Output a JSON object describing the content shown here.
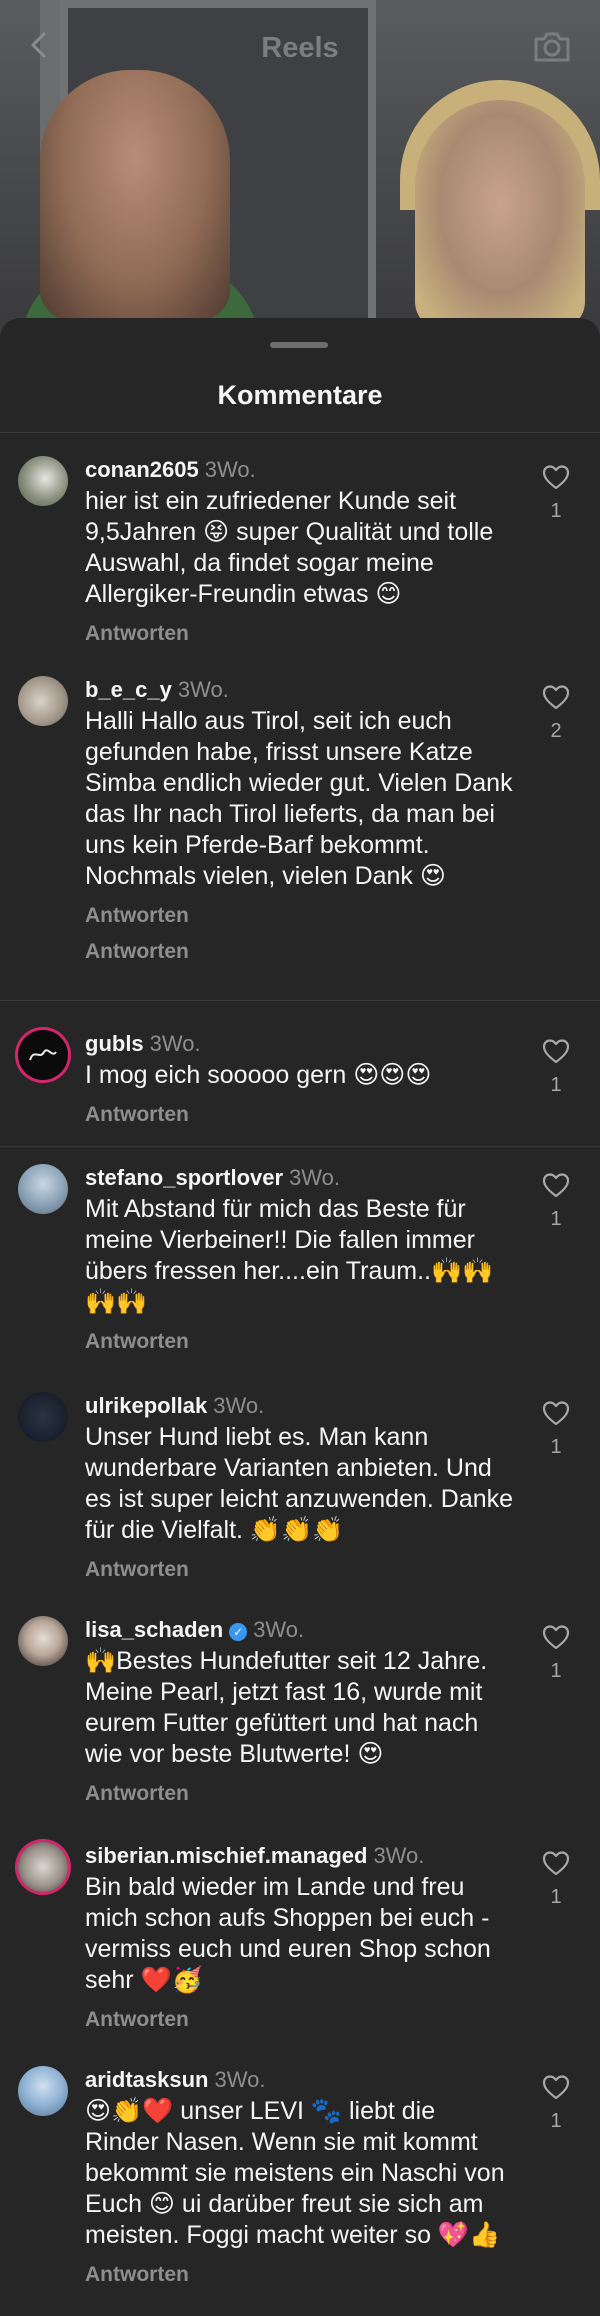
{
  "header": {
    "title": "Reels",
    "back_icon": "chevron-left-icon",
    "camera_icon": "camera-icon"
  },
  "sheet": {
    "title": "Kommentare"
  },
  "comments": [
    {
      "username": "conan2605",
      "time": "3Wo.",
      "verified": false,
      "text": "hier ist ein zufriedener Kunde seit 9,5Jahren 😝 super Qualität und tolle Auswahl, da findet sogar meine Allergiker-Freundin etwas 😊",
      "reply": "Antworten",
      "likes": "1"
    },
    {
      "username": "b_e_c_y",
      "time": "3Wo.",
      "verified": false,
      "text": "Halli Hallo aus Tirol, seit ich euch gefunden habe, frisst unsere Katze Simba endlich wieder gut. Vielen Dank das Ihr nach Tirol lieferts, da man bei uns kein Pferde-Barf bekommt. Nochmals vielen, vielen Dank 😍",
      "reply": "Antworten",
      "reply2": "Antworten",
      "likes": "2"
    },
    {
      "username": "gubls",
      "time": "3Wo.",
      "verified": false,
      "text": "I mog eich sooooo gern 😍😍😍",
      "reply": "Antworten",
      "likes": "1"
    },
    {
      "username": "stefano_sportlover",
      "time": "3Wo.",
      "verified": false,
      "text": "Mit Abstand für mich das Beste für meine  Vierbeiner!! Die fallen immer übers fressen her....ein Traum..🙌🙌🙌🙌",
      "reply": "Antworten",
      "likes": "1"
    },
    {
      "username": "ulrikepollak",
      "time": "3Wo.",
      "verified": false,
      "text": "Unser Hund liebt es. Man kann wunderbare Varianten anbieten. Und es ist super leicht anzuwenden. Danke für die Vielfalt. 👏👏👏",
      "reply": "Antworten",
      "likes": "1"
    },
    {
      "username": "lisa_schaden",
      "time": "3Wo.",
      "verified": true,
      "text": "🙌Bestes Hundefutter seit 12 Jahre. Meine Pearl, jetzt fast 16, wurde mit eurem Futter gefüttert und hat nach wie vor beste Blutwerte! 😍",
      "reply": "Antworten",
      "likes": "1"
    },
    {
      "username": "siberian.mischief.managed",
      "time": "3Wo.",
      "verified": false,
      "text": "Bin bald wieder im Lande und freu mich schon aufs Shoppen bei euch - vermiss euch und euren Shop schon sehr ❤️🥳",
      "reply": "Antworten",
      "likes": "1"
    },
    {
      "username": "aridtasksun",
      "time": "3Wo.",
      "verified": false,
      "text": "😍👏❤️ unser LEVI 🐾 liebt die Rinder Nasen. Wenn sie mit kommt bekommt sie meistens ein Naschi von Euch 😊 ui darüber freut sie sich am meisten. Foggi macht weiter so 💖👍",
      "reply": "Antworten",
      "likes": "1"
    }
  ]
}
